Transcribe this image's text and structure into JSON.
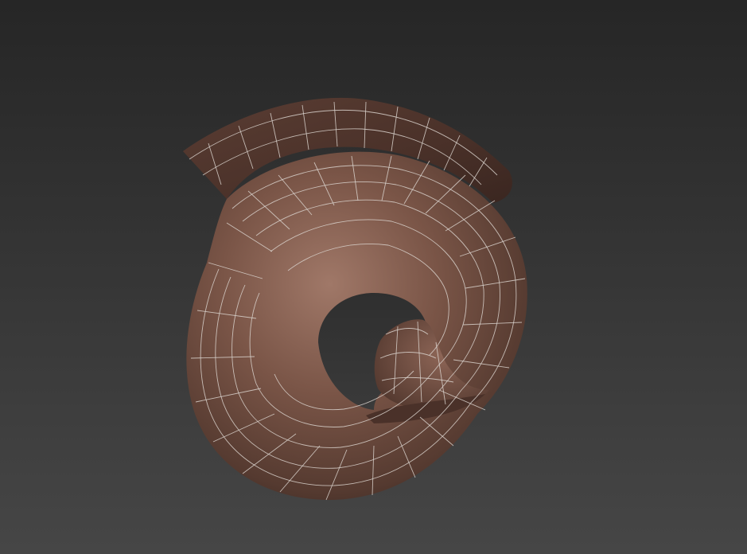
{
  "viewport": {
    "background_top": "#262626",
    "background_bottom": "#464646"
  },
  "model": {
    "kind": "ram-horn-mesh",
    "display_mode": "shaded-with-wireframe",
    "surface_color": "#7a5547",
    "shadow_color": "#3e2a23",
    "highlight_color": "#9c7464",
    "wire_color": "#d9d2cc",
    "icon": "spiral-horn-icon"
  }
}
